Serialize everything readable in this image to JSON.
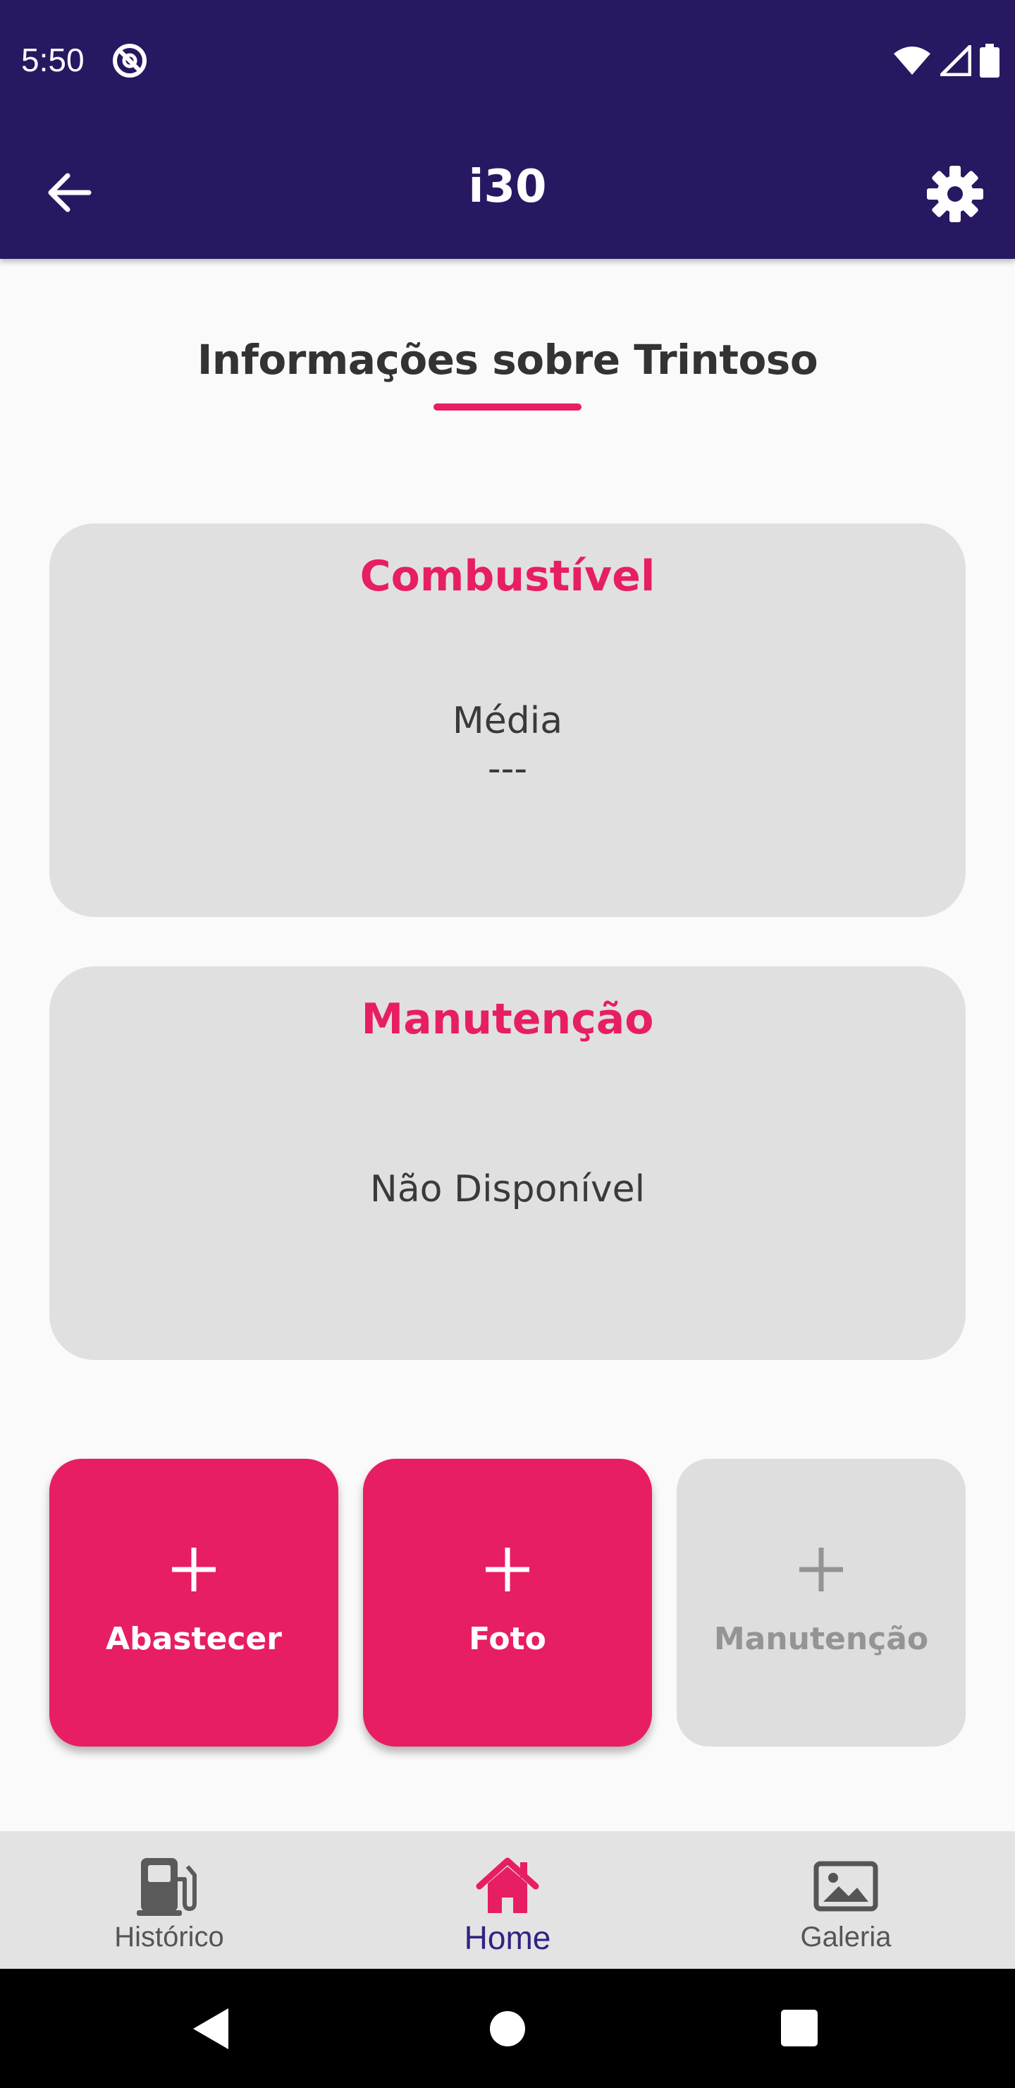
{
  "status_bar": {
    "time": "5:50",
    "icons": [
      "dnd-icon",
      "wifi-icon",
      "signal-icon",
      "battery-icon"
    ]
  },
  "app_bar": {
    "title": "i30",
    "back_icon": "arrow-back-icon",
    "settings_icon": "gear-icon"
  },
  "section": {
    "title": "Informações sobre Trintoso"
  },
  "cards": {
    "fuel": {
      "title": "Combustível",
      "line1": "Média",
      "line2": "---"
    },
    "maintenance": {
      "title": "Manutenção",
      "line1": "Não Disponível"
    }
  },
  "actions": [
    {
      "label": "Abastecer",
      "icon": "plus-icon",
      "enabled": true
    },
    {
      "label": "Foto",
      "icon": "plus-icon",
      "enabled": true
    },
    {
      "label": "Manutenção",
      "icon": "plus-icon",
      "enabled": false
    }
  ],
  "bottom_nav": [
    {
      "label": "Histórico",
      "icon": "fuel-pump-icon",
      "selected": false
    },
    {
      "label": "Home",
      "icon": "home-icon",
      "selected": true
    },
    {
      "label": "Galeria",
      "icon": "image-icon",
      "selected": false
    }
  ],
  "colors": {
    "primary": "#281862",
    "accent": "#e71e63",
    "card_bg": "#e0e0e0",
    "nav_selected": "#2f2384"
  }
}
